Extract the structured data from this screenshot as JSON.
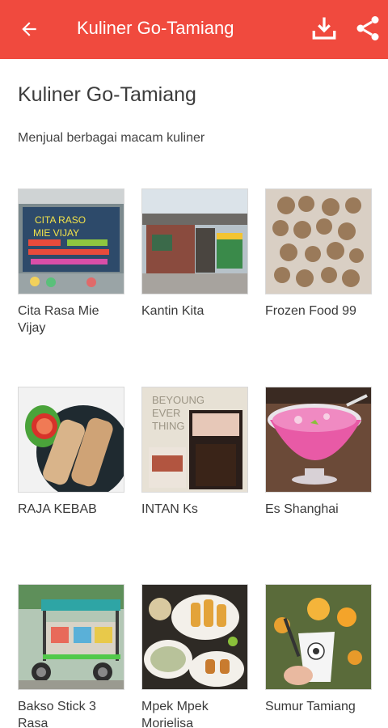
{
  "appbar": {
    "title": "Kuliner Go-Tamiang",
    "back_icon": "arrow-left-icon",
    "download_icon": "download-icon",
    "share_icon": "share-icon",
    "color": "#f04a3e"
  },
  "header": {
    "title": "Kuliner Go-Tamiang",
    "description": "Menjual berbagai macam kuliner"
  },
  "items": [
    {
      "name": "Cita Rasa Mie Vijay"
    },
    {
      "name": "Kantin Kita"
    },
    {
      "name": "Frozen Food 99"
    },
    {
      "name": "RAJA KEBAB"
    },
    {
      "name": "INTAN Ks"
    },
    {
      "name": "Es Shanghai"
    },
    {
      "name": "Bakso Stick 3 Rasa"
    },
    {
      "name": "Mpek Mpek Morielisa"
    },
    {
      "name": "Sumur Tamiang"
    }
  ],
  "images": {
    "0": {
      "text_a": "CITA RASO",
      "text_b": "MIE VIJAY"
    },
    "4": {
      "text_a": "BEYOUNG",
      "text_b": "EVER",
      "text_c": "THING"
    }
  }
}
